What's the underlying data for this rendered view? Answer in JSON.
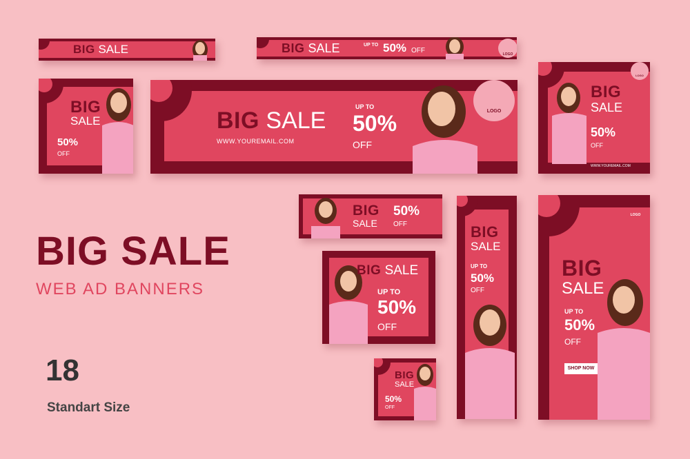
{
  "colors": {
    "background": "#f8bfc4",
    "primary": "#e0465f",
    "dark": "#7d0e25",
    "light": "#f4a9b6"
  },
  "title": {
    "main": "BIG SALE",
    "sub": "WEB AD BANNERS"
  },
  "count": {
    "number": "18",
    "label": "Standart Size"
  },
  "banner": {
    "big": "BIG",
    "sale": "SALE",
    "big_sale": "BIG SALE",
    "up_to": "UP TO",
    "percent": "50%",
    "off": "OFF",
    "email": "WWW.YOUREMAIL.COM",
    "logo": "LOGO",
    "shop_now": "SHOP NOW"
  },
  "icons": {
    "logo": "location-house-icon"
  }
}
